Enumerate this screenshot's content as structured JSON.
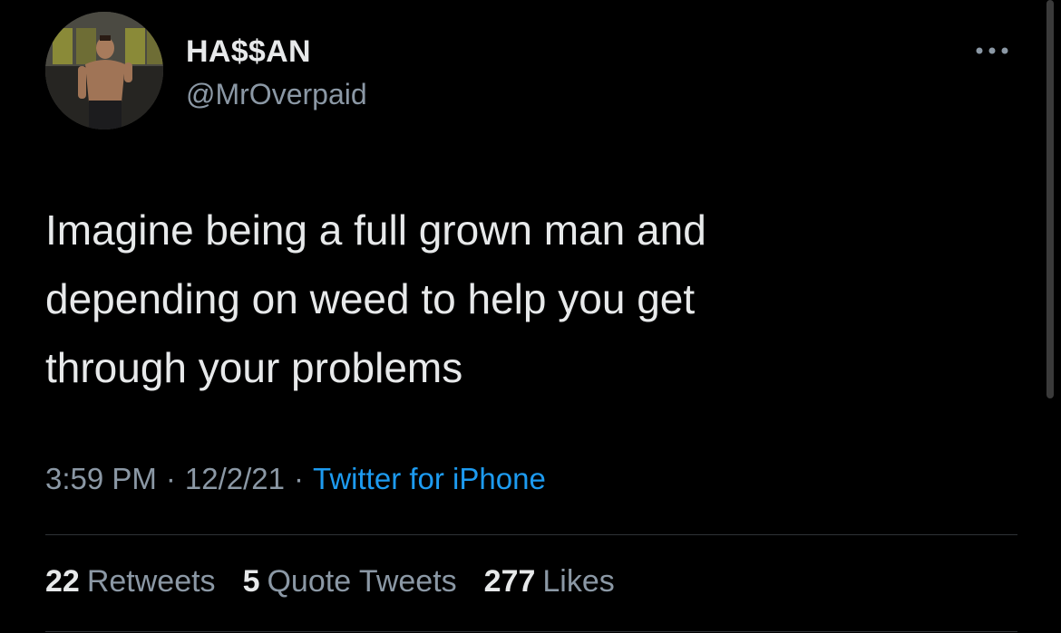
{
  "user": {
    "display_name": "HA$$AN",
    "handle": "@MrOverpaid"
  },
  "tweet": {
    "text": "Imagine being a full grown man and\ndepending on weed to help you get\nthrough your problems",
    "time": "3:59 PM",
    "date": "12/2/21",
    "separator": "·",
    "source": "Twitter for iPhone"
  },
  "stats": {
    "retweets_count": "22",
    "retweets_label": "Retweets",
    "quotes_count": "5",
    "quotes_label": "Quote Tweets",
    "likes_count": "277",
    "likes_label": "Likes"
  },
  "icons": {
    "more": "more-horizontal-icon"
  },
  "colors": {
    "background": "#000000",
    "primary_text": "#e7e9ea",
    "secondary_text": "#8b98a5",
    "link": "#1d9bf0",
    "divider": "#2f3336"
  }
}
